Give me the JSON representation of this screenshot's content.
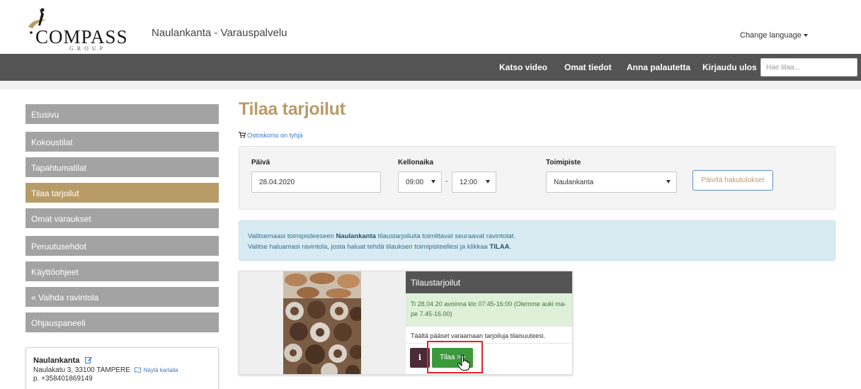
{
  "header": {
    "logo_word": "COMPASS",
    "logo_sub": "GROUP",
    "site_title": "Naulankanta - Varauspalvelu",
    "change_language": "Change language"
  },
  "navbar": {
    "items": [
      "Katso video",
      "Omat tiedot",
      "Anna palautetta",
      "Kirjaudu ulos"
    ],
    "search_placeholder": "Hae tilaa..."
  },
  "sidebar": {
    "items": [
      {
        "label": "Etusivu",
        "active": false
      },
      {
        "label": "Kokoustilat",
        "active": false
      },
      {
        "label": "Tapahtumatilat",
        "active": false
      },
      {
        "label": "Tilaa tarjoilut",
        "active": true
      },
      {
        "label": "Omat varaukset",
        "active": false
      },
      {
        "label": "Peruutusehdot",
        "active": false
      },
      {
        "label": "Käyttöohjeet",
        "active": false
      },
      {
        "label": "« Vaihda ravintola",
        "active": false
      },
      {
        "label": "Ohjauspaneeli",
        "active": false
      }
    ],
    "location": {
      "name": "Naulankanta",
      "address": "Naulakatu 3, 33100 TAMPERE",
      "map_link": "Näytä kartalla",
      "phone": "p. +358401869149"
    }
  },
  "main": {
    "title": "Tilaa tarjoilut",
    "cart_text": "Ostoskorisi on tyhjä",
    "filters": {
      "date_label": "Päivä",
      "date_value": "28.04.2020",
      "time_label": "Kellonaika",
      "time_start": "09:00",
      "time_sep": "-",
      "time_end": "12:00",
      "office_label": "Toimipiste",
      "office_value": "Naulankanta",
      "refresh_button": "Päivitä hakutulokset"
    },
    "info": {
      "line1_pre": "Valitsemaasi toimipisteeseen ",
      "line1_bold": "Naulankanta",
      "line1_post": " tilaustarjoiluita toimittavat seuraavat ravintolat.",
      "line2_pre": "Valitse haluamasi ravintola, josta haluat tehdä tilauksen toimipisteellesi ja klikkaa ",
      "line2_bold": "TILAA",
      "line2_post": "."
    },
    "card": {
      "title": "Tilaustarjoilut",
      "hours": "Ti 28.04.20 avoinna klo 07:45-16:00 (Olemme auki ma-pe 7.45-16.00)",
      "description": "Täältä pääset varaamaan tarjoiluja tilaisuuteesi.",
      "info_button": "i",
      "order_button": "Tilaa >>"
    }
  },
  "colors": {
    "accent_gold": "#b89c68",
    "navbar_bg": "#545454",
    "sidebar_bg": "#a3a3a3",
    "order_green": "#3c9a3c",
    "highlight_red": "#e0252b"
  }
}
